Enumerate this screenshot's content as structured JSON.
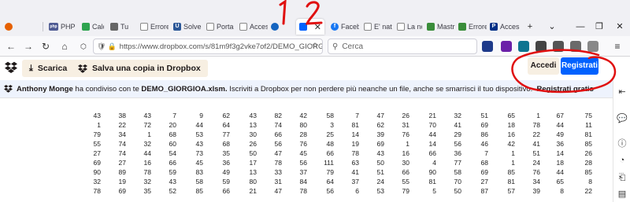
{
  "browser": {
    "tabs": [
      {
        "label": "",
        "color": "#e66000",
        "glyph": ""
      },
      {
        "label": "PHP",
        "color": "#4f5b93",
        "glyph": "php"
      },
      {
        "label": "Calc",
        "color": "#2ea44f",
        "glyph": ""
      },
      {
        "label": "Tu",
        "color": "#666666",
        "glyph": ""
      },
      {
        "label": "Errore",
        "color": "#888888",
        "glyph": ""
      },
      {
        "label": "Solve",
        "color": "#2b5797",
        "glyph": "U"
      },
      {
        "label": "Porta",
        "color": "#777777",
        "glyph": ""
      },
      {
        "label": "Acces",
        "color": "#777777",
        "glyph": ""
      },
      {
        "label": "",
        "color": "#1565c0",
        "glyph": ""
      },
      {
        "label": "",
        "color": "#0061fe",
        "glyph": ""
      },
      {
        "label": "Facebo",
        "color": "#1877f2",
        "glyph": "f"
      },
      {
        "label": "E' nat",
        "color": "#888888",
        "glyph": ""
      },
      {
        "label": "La no",
        "color": "#888888",
        "glyph": ""
      },
      {
        "label": "Mastr",
        "color": "#3a8d3a",
        "glyph": ""
      },
      {
        "label": "Errore",
        "color": "#3a8d3a",
        "glyph": ""
      },
      {
        "label": "Acces",
        "color": "#003087",
        "glyph": "P"
      }
    ],
    "url": "https://www.dropbox.com/s/81m9f3g2vke7of2/DEMO_GIORGIOA.xlsm?dl=0",
    "search_placeholder": "Cerca"
  },
  "header": {
    "download_label": "Scarica",
    "save_copy_label": "Salva una copia in Dropbox",
    "login_label": "Accedi",
    "register_label": "Registrati"
  },
  "banner": {
    "user": "Anthony Monge",
    "text1": " ha condiviso con te ",
    "file": "DEMO_GIORGIOA.xlsm.",
    "text2": " Iscriviti a Dropbox per non perdere più neanche un file, anche se smarrisci il tuo dispositivo.  ",
    "cta": "Registrati gratis"
  },
  "annotations": {
    "mark1": "1",
    "mark2": "2"
  },
  "sheet": {
    "rows": [
      [
        "43",
        "38",
        "43",
        "7",
        "9",
        "62",
        "43",
        "82",
        "42",
        "58",
        "7",
        "47",
        "26",
        "21",
        "32",
        "51",
        "65",
        "1",
        "67",
        "75"
      ],
      [
        "1",
        "22",
        "72",
        "20",
        "44",
        "64",
        "13",
        "74",
        "80",
        "3",
        "81",
        "62",
        "31",
        "70",
        "41",
        "69",
        "18",
        "78",
        "44",
        "11"
      ],
      [
        "79",
        "34",
        "1",
        "68",
        "53",
        "77",
        "30",
        "66",
        "28",
        "25",
        "14",
        "39",
        "76",
        "44",
        "29",
        "86",
        "16",
        "22",
        "49",
        "81"
      ],
      [
        "55",
        "74",
        "32",
        "60",
        "43",
        "68",
        "26",
        "56",
        "76",
        "48",
        "19",
        "69",
        "1",
        "14",
        "56",
        "46",
        "42",
        "41",
        "36",
        "85"
      ],
      [
        "27",
        "74",
        "44",
        "54",
        "73",
        "35",
        "50",
        "47",
        "45",
        "66",
        "78",
        "43",
        "16",
        "66",
        "36",
        "7",
        "1",
        "51",
        "14",
        "26"
      ],
      [
        "69",
        "27",
        "16",
        "66",
        "45",
        "36",
        "17",
        "78",
        "56",
        "111",
        "63",
        "50",
        "30",
        "4",
        "77",
        "68",
        "1",
        "24",
        "18",
        "28"
      ],
      [
        "90",
        "89",
        "78",
        "59",
        "83",
        "49",
        "13",
        "33",
        "37",
        "79",
        "41",
        "51",
        "66",
        "90",
        "58",
        "69",
        "85",
        "76",
        "44",
        "85"
      ],
      [
        "32",
        "19",
        "32",
        "43",
        "58",
        "59",
        "80",
        "31",
        "84",
        "64",
        "37",
        "24",
        "55",
        "81",
        "70",
        "27",
        "81",
        "34",
        "65",
        "8"
      ],
      [
        "78",
        "69",
        "35",
        "52",
        "85",
        "66",
        "21",
        "47",
        "78",
        "56",
        "6",
        "53",
        "79",
        "5",
        "50",
        "87",
        "57",
        "39",
        "8",
        "22"
      ]
    ]
  }
}
